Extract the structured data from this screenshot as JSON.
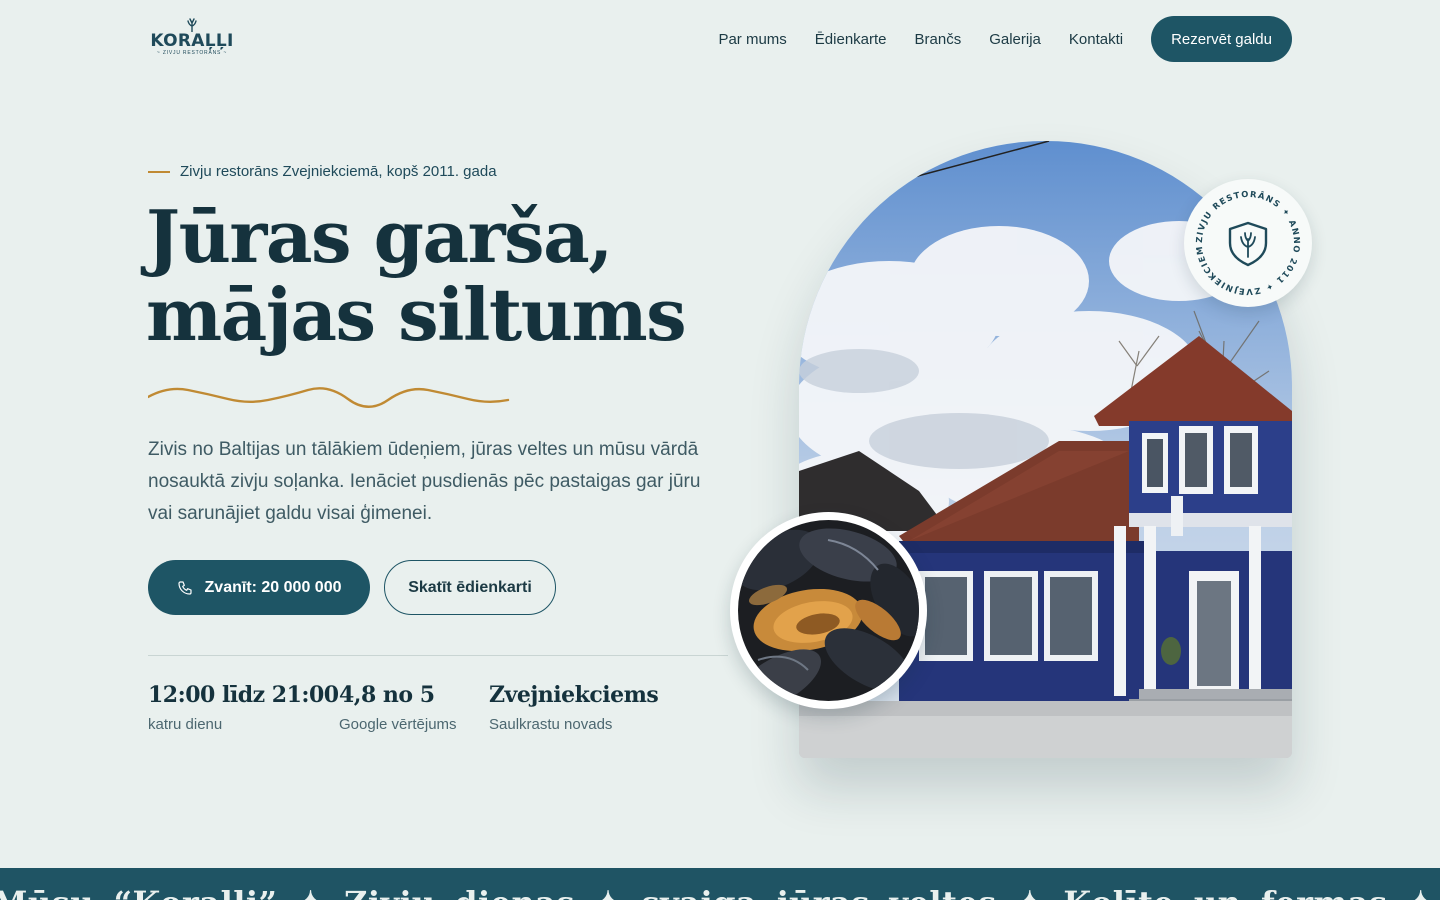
{
  "brand": {
    "name": "KORAĻĻI",
    "tagline": "ZIVJU RESTORĀNS",
    "logo_icon": "coral-icon"
  },
  "nav": {
    "links": [
      "Par mums",
      "Ēdienkarte",
      "Brančs",
      "Galerija",
      "Kontakti"
    ],
    "cta": "Rezervēt galdu"
  },
  "hero": {
    "eyebrow": "Zivju restorāns Zvejniekciemā, kopš 2011. gada",
    "title_line1": "Jūras garša,",
    "title_line2": "mājas siltums",
    "lead": "Zivis no Baltijas un tālākiem ūdeņiem, jūras veltes un mūsu vārdā nosauktā zivju soļanka. Ienāciet pusdienās pēc pastaigas gar jūru vai sarunājiet galdu visai ģimenei.",
    "call_button": "Zvanīt: 20 000 000",
    "menu_button": "Skatīt ēdienkarti"
  },
  "stats": [
    {
      "value": "12:00 līdz 21:00",
      "label": "katru dienu"
    },
    {
      "value": "4,8 no 5",
      "label": "Google vērtējums"
    },
    {
      "value": "Zvejniekciems",
      "label": "Saulkrastu novads"
    }
  ],
  "badge": {
    "ring_text": "ZIVJU RESTORĀNS ✦ ANNO 2011 ✦ ZVEJNIEKCIEMS ✦",
    "icon": "shield-coral-icon"
  },
  "marquee": {
    "text": "Mūsu “Koraļļi” ✦ Zivju dienas ✦ svaiga jūras veltes ✦ Kolīte un fermas ✦ Baltija"
  },
  "colors": {
    "background": "#e9f0ee",
    "primary": "#1e5565",
    "heading": "#15323d",
    "accent_gold": "#c08a33",
    "body_text": "#3f5b64"
  }
}
